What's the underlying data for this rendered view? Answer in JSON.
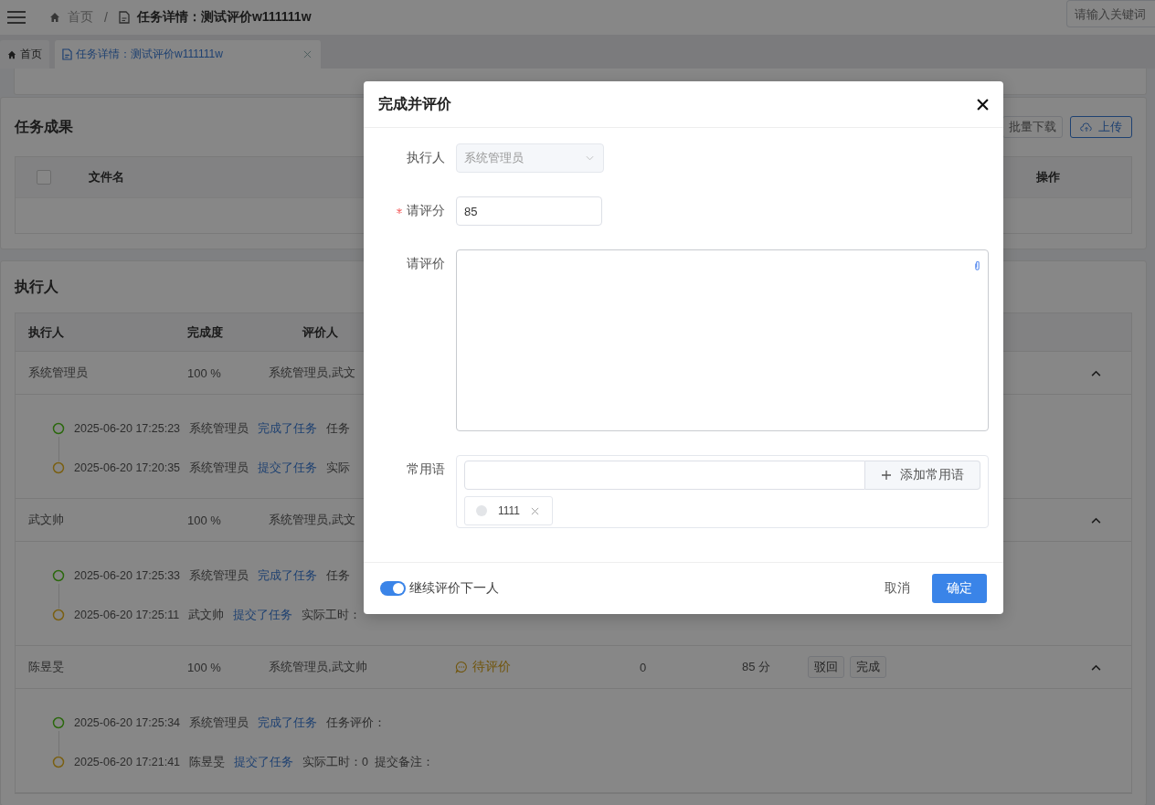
{
  "header": {
    "separator": "/",
    "breadcrumb": [
      {
        "label": "首页",
        "kind": "home"
      },
      {
        "label": "任务详情：测试评价w111111w",
        "kind": "page"
      }
    ],
    "search": {
      "placeholder": "请输入关键词"
    }
  },
  "tabs": [
    {
      "label": "首页",
      "kind": "home",
      "selected": false,
      "closable": false
    },
    {
      "label": "任务详情：测试评价w111111w",
      "kind": "page",
      "selected": true,
      "closable": true
    }
  ],
  "results_card": {
    "title": "任务成果",
    "buttons": [
      {
        "label": "批量下载",
        "kind": "default"
      },
      {
        "label": "上传",
        "kind": "upload"
      }
    ],
    "select_all": {
      "checked": false
    },
    "columns": [
      "文件名",
      "操作"
    ]
  },
  "executors_card": {
    "title": "执行人",
    "columns": [
      "执行人",
      "完成度",
      "评价人"
    ],
    "rows": [
      {
        "name": "系统管理员",
        "progress": "100 %",
        "reviewers": "系统管理员,武文",
        "expanded": true,
        "timeline": [
          {
            "kind": "complete",
            "time": "2025-06-20 17:25:23",
            "user": "系统管理员",
            "action": "完成了任务",
            "note": "任务"
          },
          {
            "kind": "submit",
            "time": "2025-06-20 17:20:35",
            "user": "系统管理员",
            "action": "提交了任务",
            "note": "实际"
          }
        ]
      },
      {
        "name": "武文帅",
        "progress": "100 %",
        "reviewers": "系统管理员,武文",
        "expanded": true,
        "timeline": [
          {
            "kind": "complete",
            "time": "2025-06-20 17:25:33",
            "user": "系统管理员",
            "action": "完成了任务",
            "note": "任务"
          },
          {
            "kind": "submit",
            "time": "2025-06-20 17:25:11",
            "user": "武文帅",
            "action": "提交了任务",
            "note": "实际工时："
          }
        ]
      },
      {
        "name": "陈昱旻",
        "progress": "100 %",
        "reviewers": "系统管理员,武文帅",
        "status": "待评价",
        "hours": "0",
        "score": "85 分",
        "actions": [
          "驳回",
          "完成"
        ],
        "expanded": true,
        "timeline": [
          {
            "kind": "complete",
            "time": "2025-06-20 17:25:34",
            "user": "系统管理员",
            "action": "完成了任务",
            "note": "任务评价："
          },
          {
            "kind": "submit",
            "time": "2025-06-20 17:21:41",
            "user": "陈昱旻",
            "action": "提交了任务",
            "note": "实际工时：0  提交备注："
          }
        ]
      }
    ]
  },
  "dialog": {
    "title": "完成并评价",
    "fields": [
      {
        "kind": "select",
        "label": "执行人",
        "disabled": true,
        "value": "系统管理员"
      },
      {
        "kind": "input",
        "label": "请评分",
        "required": true,
        "value": "85"
      },
      {
        "kind": "textarea",
        "label": "请评价"
      },
      {
        "kind": "phrases",
        "label": "常用语",
        "add_label": "添加常用语",
        "tags": [
          "1111"
        ]
      }
    ],
    "continue_next": {
      "label": "继续评价下一人",
      "on": true
    },
    "buttons": [
      {
        "label": "取消",
        "kind": "text"
      },
      {
        "label": "确定",
        "kind": "primary"
      }
    ]
  }
}
